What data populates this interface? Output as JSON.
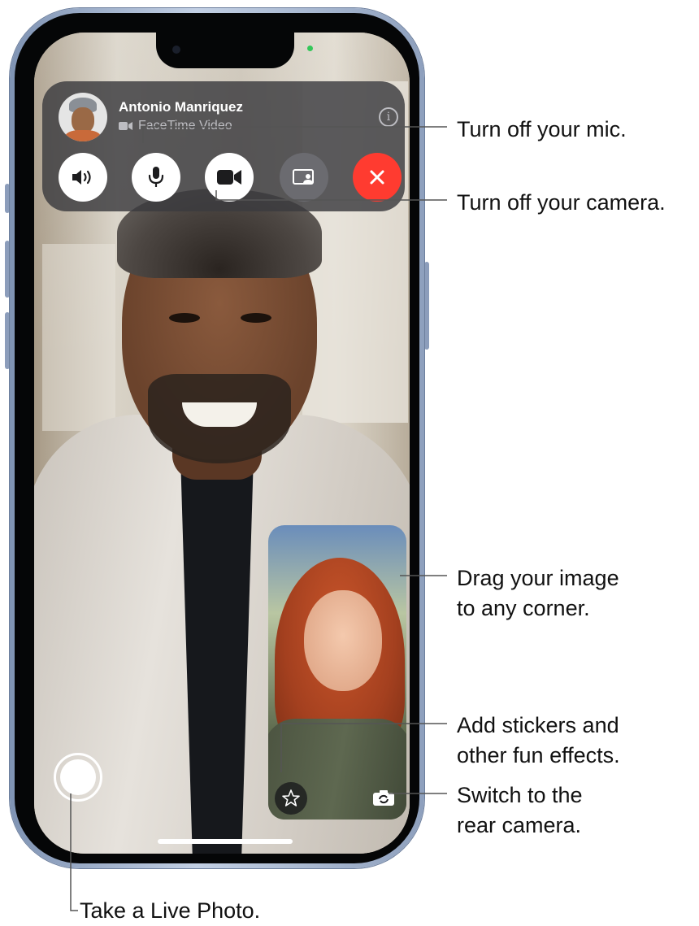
{
  "call": {
    "caller_name": "Antonio Manriquez",
    "call_type": "FaceTime Video",
    "info_icon": "info-circle-icon"
  },
  "controls": [
    {
      "name": "speaker-button",
      "icon": "speaker-wave-icon",
      "style": "white"
    },
    {
      "name": "mute-button",
      "icon": "microphone-icon",
      "style": "white"
    },
    {
      "name": "camera-button",
      "icon": "video-camera-icon",
      "style": "white"
    },
    {
      "name": "share-play-button",
      "icon": "screen-share-icon",
      "style": "grey"
    },
    {
      "name": "end-call-button",
      "icon": "close-icon",
      "style": "red"
    }
  ],
  "colors": {
    "end_call": "#ff3b30",
    "panel": "#3a3a3e",
    "frame": "#8ea0bd",
    "active_indicator": "#34c759"
  },
  "callouts": {
    "mic": "Turn off your mic.",
    "camera": "Turn off your camera.",
    "drag_line1": "Drag your image",
    "drag_line2": "to any corner.",
    "stickers_line1": "Add stickers and",
    "stickers_line2": "other fun effects.",
    "switch_line1": "Switch to the",
    "switch_line2": "rear camera.",
    "live_photo": "Take a Live Photo."
  }
}
